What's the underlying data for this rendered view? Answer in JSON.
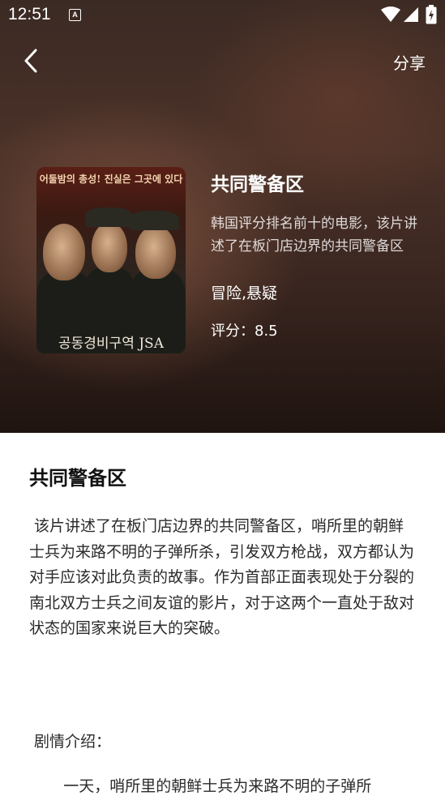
{
  "status_bar": {
    "time": "12:51",
    "notification_icon": "A"
  },
  "nav": {
    "back_icon": "chevron-left-icon",
    "share_label": "分享"
  },
  "movie": {
    "poster_top_text": "어둘밤의 총성! 진실은 그곳에 있다",
    "poster_bottom_text": "공동경비구역 JSA",
    "title": "共同警备区",
    "summary": "韩国评分排名前十的电影，该片讲述了在板门店边界的共同警备区",
    "genre": "冒险,悬疑",
    "rating": "评分：8.5"
  },
  "content": {
    "section_title": "共同警备区",
    "description": " 该片讲述了在板门店边界的共同警备区，哨所里的朝鲜士兵为来路不明的子弹所杀，引发双方枪战，双方都认为对手应该对此负责的故事。作为首部正面表现处于分裂的南北双方士兵之间友谊的影片，对于这两个一直处于敌对状态的国家来说巨大的突破。",
    "plot_label": " 剧情介绍：",
    "plot_text": "       一天，哨所里的朝鲜士兵为来路不明的子弹所"
  }
}
